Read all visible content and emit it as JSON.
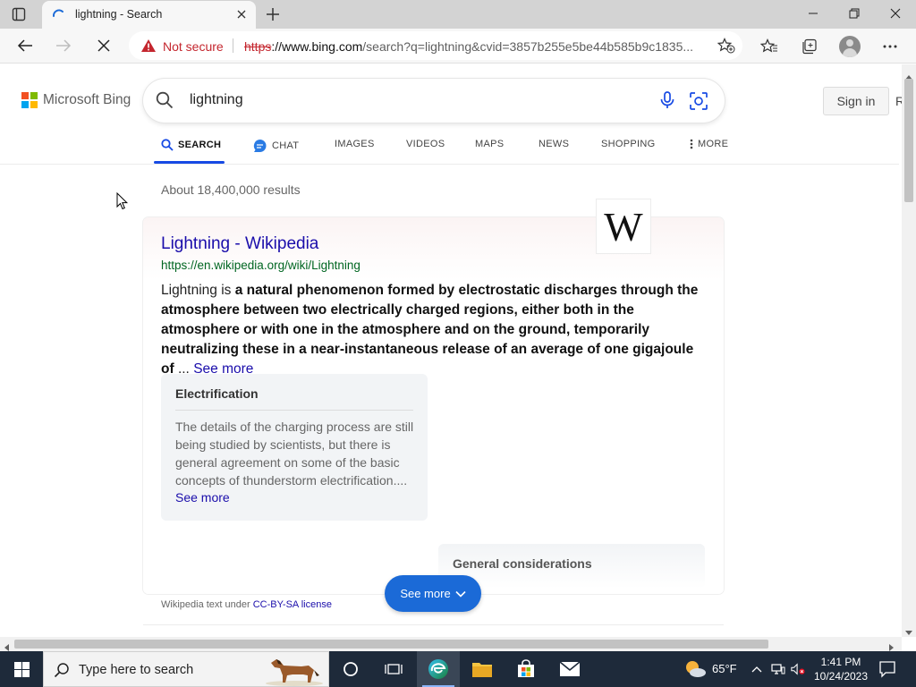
{
  "browser": {
    "tab_title": "lightning - Search",
    "security_label": "Not secure",
    "url_scheme": "https",
    "url_host": "://www.bing.com",
    "url_rest": "/search?q=lightning&cvid=3857b255e5be44b585b9c1835..."
  },
  "bing": {
    "logo_text": "Microsoft Bing",
    "query": "lightning",
    "signin_label": "Sign in",
    "signin_cut": "R",
    "scopes": [
      "SEARCH",
      "CHAT",
      "IMAGES",
      "VIDEOS",
      "MAPS",
      "NEWS",
      "SHOPPING",
      "MORE"
    ],
    "result_count": "About 18,400,000 results"
  },
  "result": {
    "title": "Lightning - Wikipedia",
    "url": "https://en.wikipedia.org/wiki/Lightning",
    "wiki_logo": "W",
    "snippet_plain": "Lightning is ",
    "snippet_bold": "a natural phenomenon formed by electrostatic discharges through the atmosphere between two electrically charged regions, either both in the atmosphere or with one in the atmosphere and on the ground, temporarily neutralizing these in a near-instantaneous release of an average of one gigajoule of",
    "snippet_ellipsis": " ... ",
    "snippet_more": "See more",
    "subcard1": {
      "heading": "Electrification",
      "body": "The details of the charging process are still being studied by scientists, but there is general agreement on some of the basic concepts of thunderstorm electrification....",
      "more": "See more"
    },
    "subcard2": {
      "heading": "General considerations"
    },
    "see_more_button": "See more",
    "license_prefix": "Wikipedia text under ",
    "license_link": "CC-BY-SA license"
  },
  "taskbar": {
    "search_placeholder": "Type here to search",
    "temperature": "65°F",
    "time": "1:41 PM",
    "date": "10/24/2023"
  },
  "colors": {
    "link": "#1a0dab",
    "url_green": "#006621",
    "bing_blue": "#174ae4",
    "button_blue": "#1b6ad7",
    "not_secure_red": "#c4262e"
  }
}
